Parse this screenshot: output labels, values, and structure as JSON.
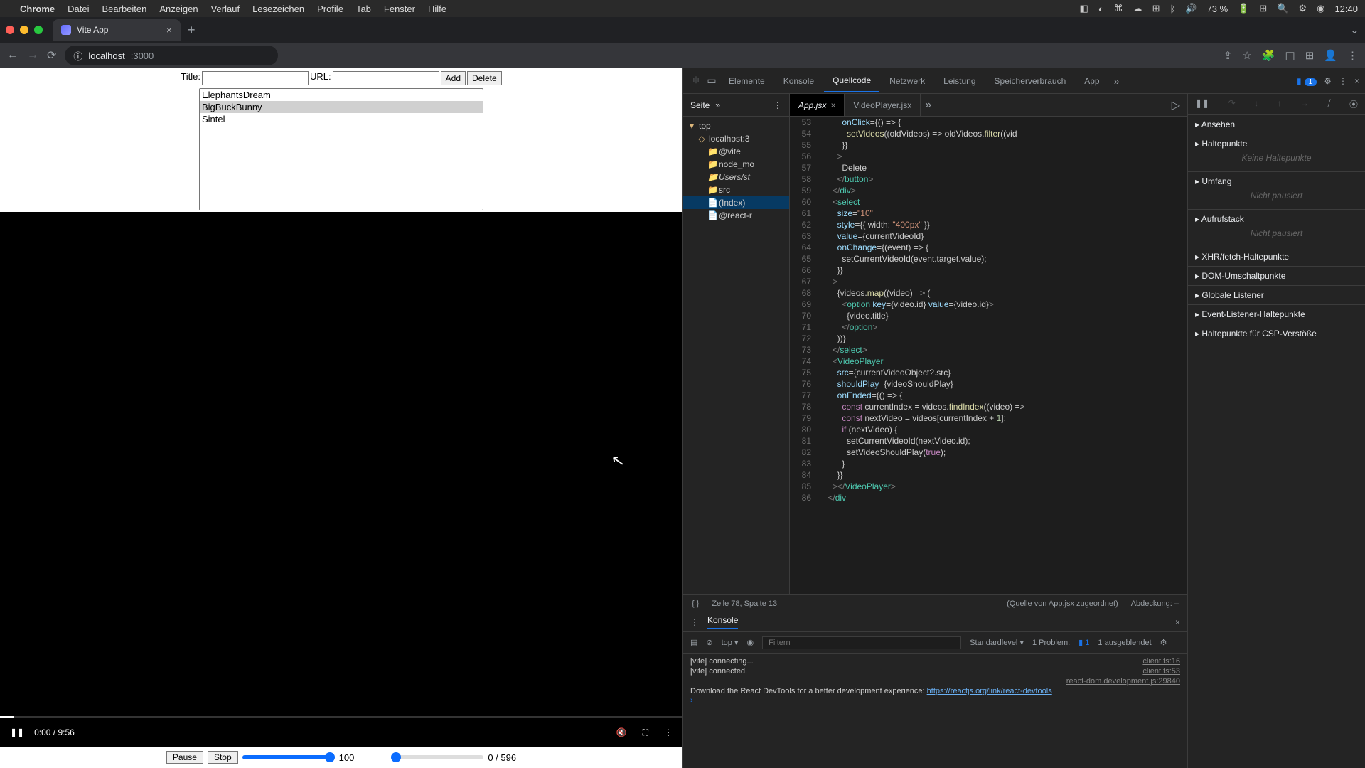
{
  "menubar": {
    "app": "Chrome",
    "items": [
      "Datei",
      "Bearbeiten",
      "Anzeigen",
      "Verlauf",
      "Lesezeichen",
      "Profile",
      "Tab",
      "Fenster",
      "Hilfe"
    ],
    "battery": "73 %",
    "time": "12:40"
  },
  "browser": {
    "tab_title": "Vite App",
    "url_host": "localhost",
    "url_port": ":3000"
  },
  "app": {
    "title_label": "Title:",
    "url_label": "URL:",
    "add_btn": "Add",
    "delete_btn": "Delete",
    "videos": [
      "ElephantsDream",
      "BigBuckBunny",
      "Sintel"
    ],
    "selected_index": 1,
    "player_time": "0:00 / 9:56",
    "pause_btn": "Pause",
    "stop_btn": "Stop",
    "volume_value": "100",
    "seek_text": "0 / 596"
  },
  "devtools": {
    "tabs": [
      "Elemente",
      "Konsole",
      "Quellcode",
      "Netzwerk",
      "Leistung",
      "Speicherverbrauch",
      "App"
    ],
    "active_tab": "Quellcode",
    "issue_count": "1",
    "sources": {
      "nav_label": "Seite",
      "file_tabs": [
        {
          "name": "App.jsx",
          "active": true
        },
        {
          "name": "VideoPlayer.jsx",
          "active": false
        }
      ],
      "tree": [
        {
          "depth": 0,
          "icon": "▾",
          "label": "top"
        },
        {
          "depth": 1,
          "icon": "◇",
          "label": "localhost:3"
        },
        {
          "depth": 2,
          "icon": "📁",
          "cls": "blue",
          "label": "@vite"
        },
        {
          "depth": 2,
          "icon": "📁",
          "cls": "blue",
          "label": "node_mo"
        },
        {
          "depth": 2,
          "icon": "📁",
          "cls": "",
          "label": "Users/st",
          "italic": true
        },
        {
          "depth": 2,
          "icon": "📁",
          "cls": "",
          "label": "src"
        },
        {
          "depth": 2,
          "icon": "📄",
          "cls": "",
          "label": "(Index)",
          "sel": true
        },
        {
          "depth": 2,
          "icon": "📄",
          "cls": "",
          "label": "@react-r"
        }
      ],
      "status": {
        "braces": "{ }",
        "pos": "Zeile 78, Spalte 13",
        "mapped": "(Quelle von App.jsx zugeordnet)",
        "coverage": "Abdeckung: –"
      }
    },
    "sidepane": [
      {
        "title": "Ansehen",
        "body": ""
      },
      {
        "title": "Haltepunkte",
        "body": "Keine Haltepunkte"
      },
      {
        "title": "Umfang",
        "body": "Nicht pausiert"
      },
      {
        "title": "Aufrufstack",
        "body": "Nicht pausiert"
      },
      {
        "title": "XHR/fetch-Haltepunkte",
        "body": ""
      },
      {
        "title": "DOM-Umschaltpunkte",
        "body": ""
      },
      {
        "title": "Globale Listener",
        "body": ""
      },
      {
        "title": "Event-Listener-Haltepunkte",
        "body": ""
      },
      {
        "title": "Haltepunkte für CSP-Verstöße",
        "body": ""
      }
    ],
    "code_lines": [
      {
        "n": 53,
        "html": "          <span class='attr'>onClick</span>={() => {"
      },
      {
        "n": 54,
        "html": "            <span class='fn'>setVideos</span>((oldVideos) =&gt; oldVideos.<span class='fn'>filter</span>((vid"
      },
      {
        "n": 55,
        "html": "          }}"
      },
      {
        "n": 56,
        "html": "        <span class='jsx'>&gt;</span>"
      },
      {
        "n": 57,
        "html": "          Delete"
      },
      {
        "n": 58,
        "html": "        <span class='jsx'>&lt;/</span><span class='tag'>button</span><span class='jsx'>&gt;</span>"
      },
      {
        "n": 59,
        "html": "      <span class='jsx'>&lt;/</span><span class='tag'>div</span><span class='jsx'>&gt;</span>"
      },
      {
        "n": 60,
        "html": "      <span class='jsx'>&lt;</span><span class='tag'>select</span>"
      },
      {
        "n": 61,
        "html": "        <span class='attr'>size</span>=<span class='str'>\"10\"</span>"
      },
      {
        "n": 62,
        "html": "        <span class='attr'>style</span>={{ width: <span class='str'>\"400px\"</span> }}"
      },
      {
        "n": 63,
        "html": "        <span class='attr'>value</span>={currentVideoId}"
      },
      {
        "n": 64,
        "html": "        <span class='attr'>onChange</span>={(event) =&gt; {"
      },
      {
        "n": 65,
        "html": "          setCurrentVideoId(event.target.value);"
      },
      {
        "n": 66,
        "html": "        }}"
      },
      {
        "n": 67,
        "html": "      <span class='jsx'>&gt;</span>"
      },
      {
        "n": 68,
        "html": "        {videos.<span class='fn'>map</span>((video) =&gt; ("
      },
      {
        "n": 69,
        "html": "          <span class='jsx'>&lt;</span><span class='tag'>option</span> <span class='attr'>key</span>={video.id} <span class='attr'>value</span>={video.id}<span class='jsx'>&gt;</span>"
      },
      {
        "n": 70,
        "html": "            {video.title}"
      },
      {
        "n": 71,
        "html": "          <span class='jsx'>&lt;/</span><span class='tag'>option</span><span class='jsx'>&gt;</span>"
      },
      {
        "n": 72,
        "html": "        ))}"
      },
      {
        "n": 73,
        "html": "      <span class='jsx'>&lt;/</span><span class='tag'>select</span><span class='jsx'>&gt;</span>"
      },
      {
        "n": 74,
        "html": "      <span class='jsx'>&lt;</span><span class='tag'>VideoPlayer</span>"
      },
      {
        "n": 75,
        "html": "        <span class='attr'>src</span>={currentVideoObject?.src}"
      },
      {
        "n": 76,
        "html": "        <span class='attr'>shouldPlay</span>={videoShouldPlay}"
      },
      {
        "n": 77,
        "html": "        <span class='attr'>onEnded</span>={() =&gt; {"
      },
      {
        "n": 78,
        "html": "          <span class='kw'>const</span> currentIndex = videos.<span class='fn'>findIndex</span>((video) =&gt;"
      },
      {
        "n": 79,
        "html": "          <span class='kw'>const</span> nextVideo = videos[currentIndex + <span class='num'>1</span>];"
      },
      {
        "n": 80,
        "html": "          <span class='kw'>if</span> (nextVideo) {"
      },
      {
        "n": 81,
        "html": "            setCurrentVideoId(nextVideo.id);"
      },
      {
        "n": 82,
        "html": "            setVideoShouldPlay(<span class='kw'>true</span>);"
      },
      {
        "n": 83,
        "html": "          }"
      },
      {
        "n": 84,
        "html": "        }}"
      },
      {
        "n": 85,
        "html": "      <span class='jsx'>&gt;&lt;/</span><span class='tag'>VideoPlayer</span><span class='jsx'>&gt;</span>"
      },
      {
        "n": 86,
        "html": "    <span class='jsx'>&lt;/</span><span class='tag'>div</span>"
      }
    ],
    "console": {
      "title": "Konsole",
      "ctx": "top",
      "filter_ph": "Filtern",
      "level": "Standardlevel",
      "problems_label": "1 Problem:",
      "problems_count": "1",
      "hidden": "1 ausgeblendet",
      "lines": [
        {
          "text": "[vite] connecting...",
          "src": "client.ts:16"
        },
        {
          "text": "[vite] connected.",
          "src": "client.ts:53"
        },
        {
          "text": "",
          "src": "react-dom.development.js:29840"
        },
        {
          "text": "Download the React DevTools for a better development experience: ",
          "link": "https://reactjs.org/link/react-devtools",
          "src": ""
        }
      ]
    }
  }
}
